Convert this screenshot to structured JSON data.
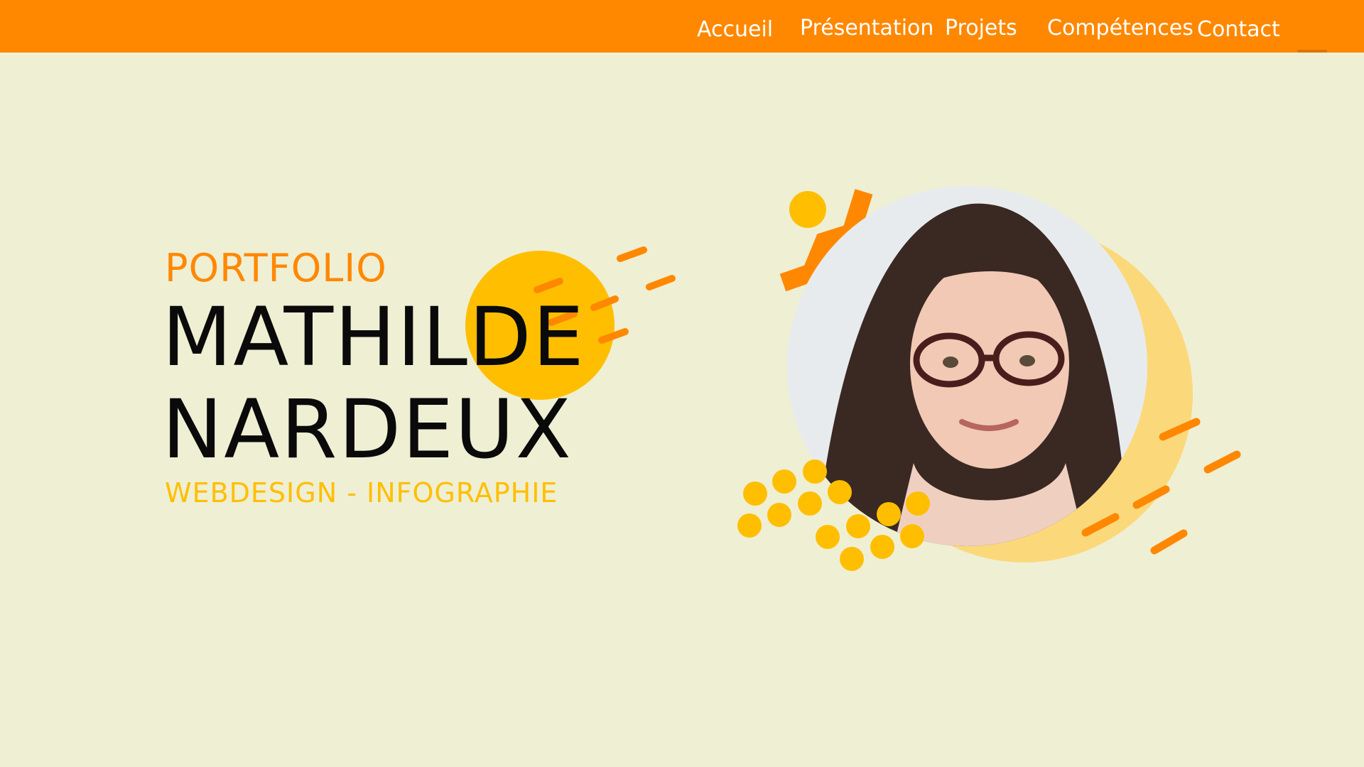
{
  "nav": {
    "items": [
      {
        "label": "Accueil"
      },
      {
        "label": "Présentation"
      },
      {
        "label": "Projets"
      },
      {
        "label": "Compétences"
      },
      {
        "label": "Contact"
      }
    ]
  },
  "hero": {
    "kicker": "PORTFOLIO",
    "first_name": "MATHILDE",
    "last_name": "NARDEUX",
    "tagline": "WEBDESIGN - INFOGRAPHIE"
  },
  "colors": {
    "background": "#efefd4",
    "accent_orange": "#ff8800",
    "accent_yellow": "#ffbf00",
    "soft_yellow": "#fbd97a"
  }
}
